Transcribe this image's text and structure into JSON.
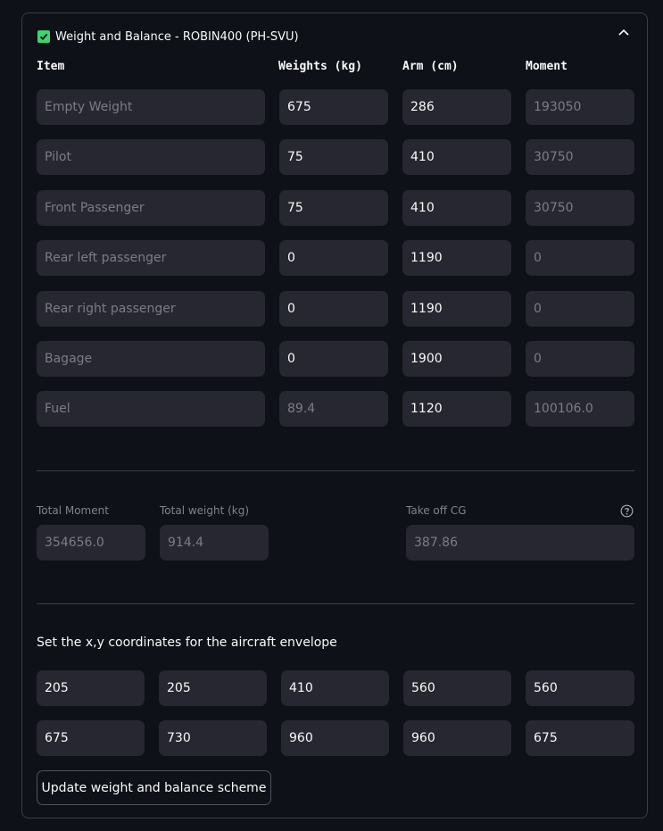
{
  "expander": {
    "title": "Weight and Balance - ROBIN400 (PH-SVU)"
  },
  "columns": {
    "item": "Item",
    "weights": "Weights (kg)",
    "arm": "Arm (cm)",
    "moment": "Moment"
  },
  "rows": [
    {
      "item": "Empty Weight",
      "weight": "675",
      "arm": "286",
      "moment": "193050"
    },
    {
      "item": "Pilot",
      "weight": "75",
      "arm": "410",
      "moment": "30750"
    },
    {
      "item": "Front Passenger",
      "weight": "75",
      "arm": "410",
      "moment": "30750"
    },
    {
      "item": "Rear left passenger",
      "weight": "0",
      "arm": "1190",
      "moment": "0"
    },
    {
      "item": "Rear right passenger",
      "weight": "0",
      "arm": "1190",
      "moment": "0"
    },
    {
      "item": "Bagage",
      "weight": "0",
      "arm": "1900",
      "moment": "0"
    },
    {
      "item": "Fuel",
      "weight": "89.4",
      "arm": "1120",
      "moment": "100106.0"
    }
  ],
  "totals": {
    "moment_label": "Total Moment",
    "moment_value": "354656.0",
    "weight_label": "Total weight (kg)",
    "weight_value": "914.4",
    "cg_label": "Take off CG",
    "cg_value": "387.86"
  },
  "envelope": {
    "title": "Set the x,y coordinates for the aircraft envelope",
    "x": [
      "205",
      "205",
      "410",
      "560",
      "560"
    ],
    "y": [
      "675",
      "730",
      "960",
      "960",
      "675"
    ]
  },
  "update_button": "Update weight and balance scheme",
  "colors": {
    "accent": "#3dd56d",
    "input_bg": "#262730",
    "page_bg": "#0e1117"
  }
}
